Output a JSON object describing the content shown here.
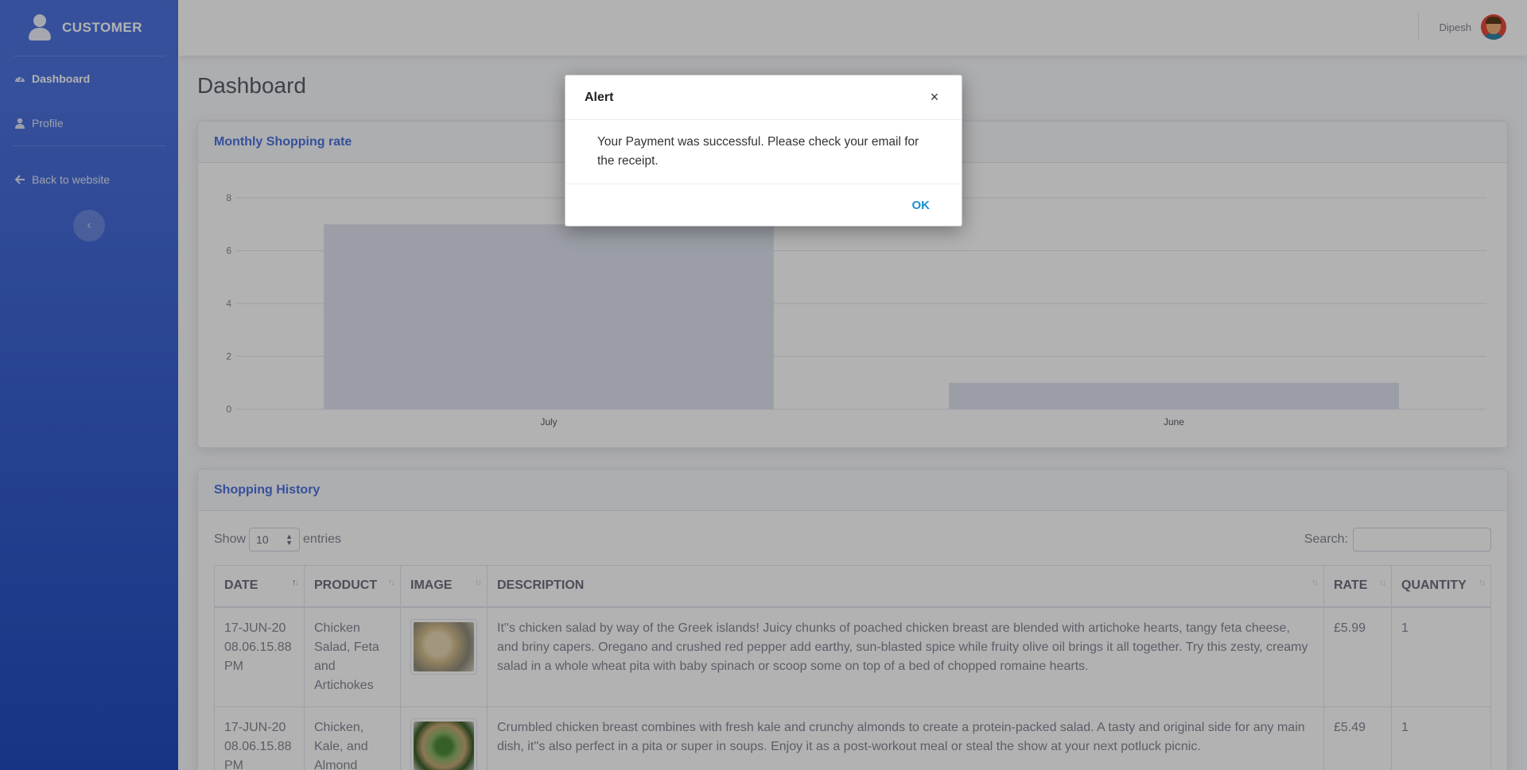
{
  "sidebar": {
    "brand": "CUSTOMER",
    "items": [
      {
        "label": "Dashboard",
        "icon": "tachometer-icon"
      },
      {
        "label": "Profile",
        "icon": "user-icon"
      },
      {
        "label": "Back to website",
        "icon": "arrow-left-icon"
      }
    ],
    "toggle_icon": "chevron-left-icon"
  },
  "topbar": {
    "user_name": "Dipesh"
  },
  "page": {
    "title": "Dashboard"
  },
  "chart_card": {
    "title": "Monthly Shopping rate"
  },
  "chart_data": {
    "type": "bar",
    "categories": [
      "July",
      "June"
    ],
    "values": [
      7,
      1
    ],
    "ylim": [
      0,
      8
    ],
    "yticks": [
      0,
      2,
      4,
      6,
      8
    ],
    "grid": true
  },
  "history": {
    "title": "Shopping History",
    "show_label": "Show",
    "entries_value": "10",
    "entries_label": "entries",
    "search_label": "Search:",
    "columns": [
      "DATE",
      "PRODUCT",
      "IMAGE",
      "DESCRIPTION",
      "RATE",
      "QUANTITY"
    ],
    "rows": [
      {
        "date": "17-JUN-20 08.06.15.88 PM",
        "product": "Chicken Salad, Feta and Artichokes",
        "description": "It''s chicken salad by way of the Greek islands! Juicy chunks of poached chicken breast are blended with artichoke hearts, tangy feta cheese, and briny capers. Oregano and crushed red pepper add earthy, sun-blasted spice while fruity olive oil brings it all together. Try this zesty, creamy salad in a whole wheat pita with baby spinach or scoop some on top of a bed of chopped romaine hearts.",
        "rate": "£5.99",
        "quantity": "1"
      },
      {
        "date": "17-JUN-20 08.06.15.88 PM",
        "product": "Chicken, Kale, and Almond",
        "description": "Crumbled chicken breast combines with fresh kale and crunchy almonds to create a protein-packed salad. A tasty and original side for any main dish, it''s also perfect in a pita or super in soups. Enjoy it as a post-workout meal or steal the show at your next potluck picnic.",
        "rate": "£5.49",
        "quantity": "1"
      }
    ]
  },
  "modal": {
    "title": "Alert",
    "close": "×",
    "message": "Your Payment was successful. Please check your email for the receipt.",
    "ok": "OK"
  },
  "colors": {
    "sidebar": "#4e73df",
    "accent": "#4e73df",
    "ok_link": "#1a8fd1"
  }
}
